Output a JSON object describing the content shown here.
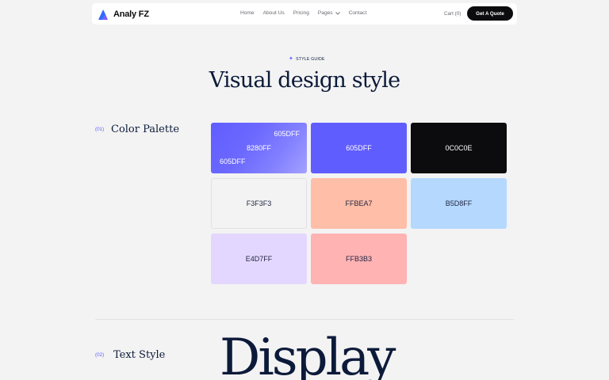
{
  "nav": {
    "brand": "Analy FZ",
    "menu": [
      "Home",
      "About Us",
      "Pricing",
      "Pages",
      "Contact"
    ],
    "cart": "Cart (0)",
    "quote_button": "Get A Quote"
  },
  "hero": {
    "eyebrow": "STYLE GUIDE",
    "title": "Visual design style"
  },
  "palette": {
    "number": "(01)",
    "title": "Color Palette",
    "gradient": [
      "605DFF",
      "8280FF",
      "605DFF"
    ],
    "swatches": [
      {
        "label": "605DFF",
        "color": "#605dff"
      },
      {
        "label": "0C0C0E",
        "color": "#0c0c0e"
      },
      {
        "label": "F3F3F3",
        "color": "#f3f3f3"
      },
      {
        "label": "FFBEA7",
        "color": "#ffbea7"
      },
      {
        "label": "B5D8FF",
        "color": "#b5d8ff"
      },
      {
        "label": "E4D7FF",
        "color": "#e4d7ff"
      },
      {
        "label": "FFB3B3",
        "color": "#ffb3b3"
      }
    ]
  },
  "text_style": {
    "number": "(02)",
    "title": "Text Style",
    "display": "Display"
  },
  "colors": {
    "accent": "#605dff",
    "dark": "#0c0c0e",
    "background": "#f3f3f3",
    "heading": "#0c1a3a"
  }
}
